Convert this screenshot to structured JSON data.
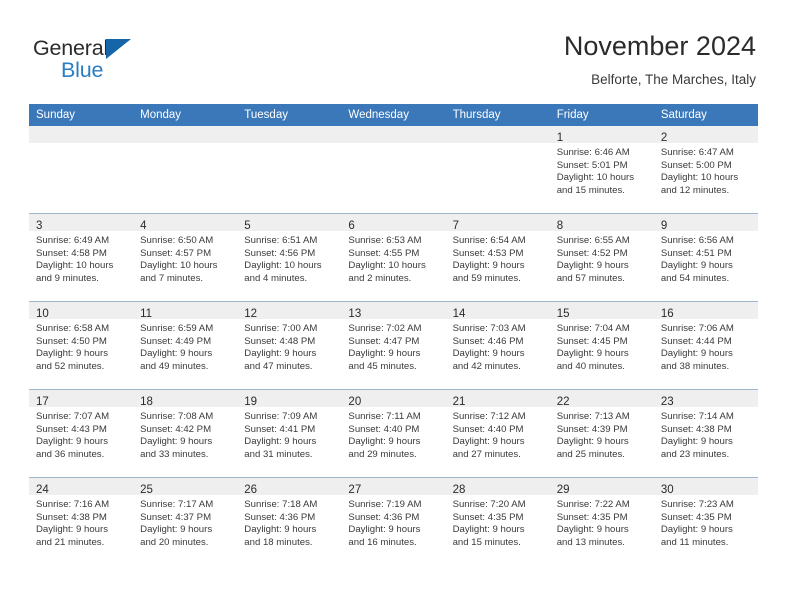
{
  "brand": {
    "word1": "General",
    "word2": "Blue",
    "triangle_color": "#1565a8",
    "blue_color": "#2b7ec1"
  },
  "header": {
    "title": "November 2024",
    "subtitle": "Belforte, The Marches, Italy"
  },
  "theme": {
    "header_bg": "#3b78ba",
    "daynum_band_bg": "#efefef",
    "row_border": "#9fb6d0"
  },
  "weekdays": [
    "Sunday",
    "Monday",
    "Tuesday",
    "Wednesday",
    "Thursday",
    "Friday",
    "Saturday"
  ],
  "weeks": [
    [
      {
        "day": "",
        "lines": []
      },
      {
        "day": "",
        "lines": []
      },
      {
        "day": "",
        "lines": []
      },
      {
        "day": "",
        "lines": []
      },
      {
        "day": "",
        "lines": []
      },
      {
        "day": "1",
        "lines": [
          "Sunrise: 6:46 AM",
          "Sunset: 5:01 PM",
          "Daylight: 10 hours",
          "and 15 minutes."
        ]
      },
      {
        "day": "2",
        "lines": [
          "Sunrise: 6:47 AM",
          "Sunset: 5:00 PM",
          "Daylight: 10 hours",
          "and 12 minutes."
        ]
      }
    ],
    [
      {
        "day": "3",
        "lines": [
          "Sunrise: 6:49 AM",
          "Sunset: 4:58 PM",
          "Daylight: 10 hours",
          "and 9 minutes."
        ]
      },
      {
        "day": "4",
        "lines": [
          "Sunrise: 6:50 AM",
          "Sunset: 4:57 PM",
          "Daylight: 10 hours",
          "and 7 minutes."
        ]
      },
      {
        "day": "5",
        "lines": [
          "Sunrise: 6:51 AM",
          "Sunset: 4:56 PM",
          "Daylight: 10 hours",
          "and 4 minutes."
        ]
      },
      {
        "day": "6",
        "lines": [
          "Sunrise: 6:53 AM",
          "Sunset: 4:55 PM",
          "Daylight: 10 hours",
          "and 2 minutes."
        ]
      },
      {
        "day": "7",
        "lines": [
          "Sunrise: 6:54 AM",
          "Sunset: 4:53 PM",
          "Daylight: 9 hours",
          "and 59 minutes."
        ]
      },
      {
        "day": "8",
        "lines": [
          "Sunrise: 6:55 AM",
          "Sunset: 4:52 PM",
          "Daylight: 9 hours",
          "and 57 minutes."
        ]
      },
      {
        "day": "9",
        "lines": [
          "Sunrise: 6:56 AM",
          "Sunset: 4:51 PM",
          "Daylight: 9 hours",
          "and 54 minutes."
        ]
      }
    ],
    [
      {
        "day": "10",
        "lines": [
          "Sunrise: 6:58 AM",
          "Sunset: 4:50 PM",
          "Daylight: 9 hours",
          "and 52 minutes."
        ]
      },
      {
        "day": "11",
        "lines": [
          "Sunrise: 6:59 AM",
          "Sunset: 4:49 PM",
          "Daylight: 9 hours",
          "and 49 minutes."
        ]
      },
      {
        "day": "12",
        "lines": [
          "Sunrise: 7:00 AM",
          "Sunset: 4:48 PM",
          "Daylight: 9 hours",
          "and 47 minutes."
        ]
      },
      {
        "day": "13",
        "lines": [
          "Sunrise: 7:02 AM",
          "Sunset: 4:47 PM",
          "Daylight: 9 hours",
          "and 45 minutes."
        ]
      },
      {
        "day": "14",
        "lines": [
          "Sunrise: 7:03 AM",
          "Sunset: 4:46 PM",
          "Daylight: 9 hours",
          "and 42 minutes."
        ]
      },
      {
        "day": "15",
        "lines": [
          "Sunrise: 7:04 AM",
          "Sunset: 4:45 PM",
          "Daylight: 9 hours",
          "and 40 minutes."
        ]
      },
      {
        "day": "16",
        "lines": [
          "Sunrise: 7:06 AM",
          "Sunset: 4:44 PM",
          "Daylight: 9 hours",
          "and 38 minutes."
        ]
      }
    ],
    [
      {
        "day": "17",
        "lines": [
          "Sunrise: 7:07 AM",
          "Sunset: 4:43 PM",
          "Daylight: 9 hours",
          "and 36 minutes."
        ]
      },
      {
        "day": "18",
        "lines": [
          "Sunrise: 7:08 AM",
          "Sunset: 4:42 PM",
          "Daylight: 9 hours",
          "and 33 minutes."
        ]
      },
      {
        "day": "19",
        "lines": [
          "Sunrise: 7:09 AM",
          "Sunset: 4:41 PM",
          "Daylight: 9 hours",
          "and 31 minutes."
        ]
      },
      {
        "day": "20",
        "lines": [
          "Sunrise: 7:11 AM",
          "Sunset: 4:40 PM",
          "Daylight: 9 hours",
          "and 29 minutes."
        ]
      },
      {
        "day": "21",
        "lines": [
          "Sunrise: 7:12 AM",
          "Sunset: 4:40 PM",
          "Daylight: 9 hours",
          "and 27 minutes."
        ]
      },
      {
        "day": "22",
        "lines": [
          "Sunrise: 7:13 AM",
          "Sunset: 4:39 PM",
          "Daylight: 9 hours",
          "and 25 minutes."
        ]
      },
      {
        "day": "23",
        "lines": [
          "Sunrise: 7:14 AM",
          "Sunset: 4:38 PM",
          "Daylight: 9 hours",
          "and 23 minutes."
        ]
      }
    ],
    [
      {
        "day": "24",
        "lines": [
          "Sunrise: 7:16 AM",
          "Sunset: 4:38 PM",
          "Daylight: 9 hours",
          "and 21 minutes."
        ]
      },
      {
        "day": "25",
        "lines": [
          "Sunrise: 7:17 AM",
          "Sunset: 4:37 PM",
          "Daylight: 9 hours",
          "and 20 minutes."
        ]
      },
      {
        "day": "26",
        "lines": [
          "Sunrise: 7:18 AM",
          "Sunset: 4:36 PM",
          "Daylight: 9 hours",
          "and 18 minutes."
        ]
      },
      {
        "day": "27",
        "lines": [
          "Sunrise: 7:19 AM",
          "Sunset: 4:36 PM",
          "Daylight: 9 hours",
          "and 16 minutes."
        ]
      },
      {
        "day": "28",
        "lines": [
          "Sunrise: 7:20 AM",
          "Sunset: 4:35 PM",
          "Daylight: 9 hours",
          "and 15 minutes."
        ]
      },
      {
        "day": "29",
        "lines": [
          "Sunrise: 7:22 AM",
          "Sunset: 4:35 PM",
          "Daylight: 9 hours",
          "and 13 minutes."
        ]
      },
      {
        "day": "30",
        "lines": [
          "Sunrise: 7:23 AM",
          "Sunset: 4:35 PM",
          "Daylight: 9 hours",
          "and 11 minutes."
        ]
      }
    ]
  ]
}
